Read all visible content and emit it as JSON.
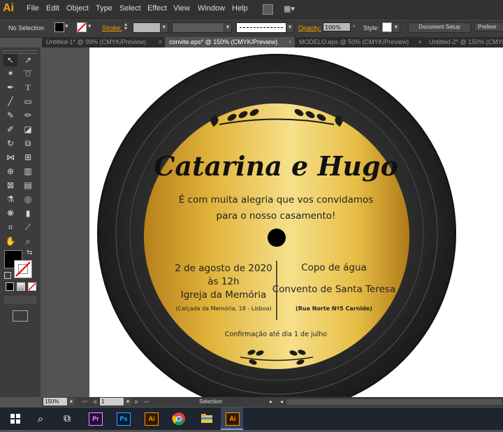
{
  "app": {
    "logo": "Ai"
  },
  "menu": [
    "File",
    "Edit",
    "Object",
    "Type",
    "Select",
    "Effect",
    "View",
    "Window",
    "Help"
  ],
  "control_bar": {
    "selection_status": "No Selection",
    "stroke_label": "Stroke:",
    "opacity_label": "Opacity:",
    "opacity_value": "100%",
    "style_label": "Style:",
    "document_setup": "Document Setup",
    "preferences": "Prefere"
  },
  "tabs": [
    {
      "label": "Untitled-1* @ 99% (CMYK/Preview)",
      "active": false
    },
    {
      "label": "convite.eps* @ 150% (CMYK/Preview)",
      "active": true
    },
    {
      "label": "MODELO.eps @ 50% (CMYK/Preview)",
      "active": false
    },
    {
      "label": "Untitled-2* @ 150% (CMYK/Previ",
      "active": false
    }
  ],
  "invitation": {
    "names": "Catarina e Hugo",
    "intro_line1": "É com muita alegria que vos convidamos",
    "intro_line2": "para o nosso casamento!",
    "date": "2 de agosto de 2020",
    "time": "às 12h",
    "church": "Igreja da Memória",
    "church_address": "(Calçada da Memória, 18 - Lisboa)",
    "reception": "Copo de água",
    "venue": "Convento de Santa Teresa",
    "venue_address": "(Rua Norte Nº5 Carnide)",
    "rsvp": "Confirmação até dia 1 de julho",
    "gold_color": "#e8b52a",
    "vinyl_color": "#2e2e2e"
  },
  "status_bar": {
    "zoom": "150%",
    "artboard": "1",
    "tool": "Selection"
  },
  "taskbar": [
    "windows-start",
    "search",
    "task-view",
    "Pr",
    "Ps",
    "Ai",
    "chrome",
    "file-explorer",
    "Ai"
  ]
}
